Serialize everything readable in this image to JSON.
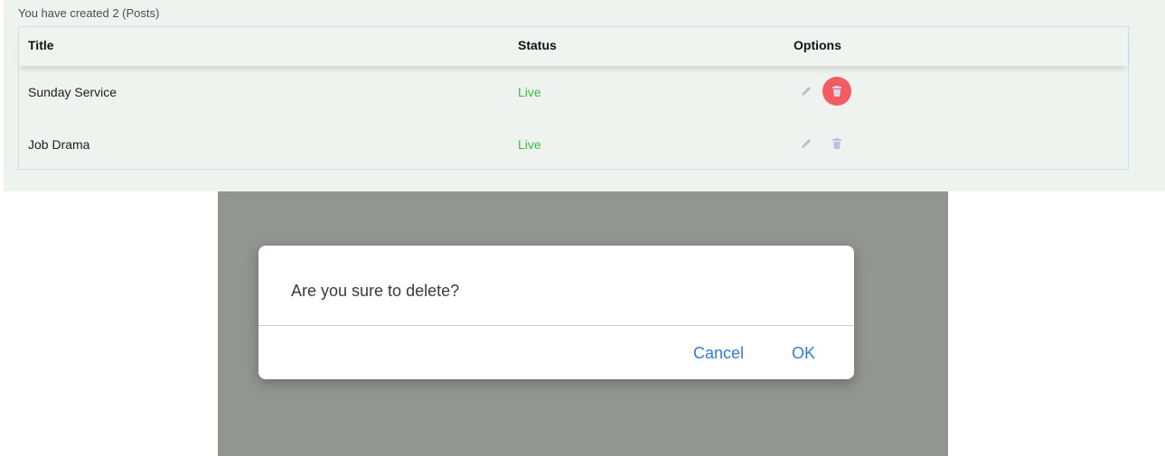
{
  "summary": "You have created 2 (Posts)",
  "table": {
    "headers": {
      "title": "Title",
      "status": "Status",
      "options": "Options"
    },
    "rows": [
      {
        "title": "Sunday Service",
        "status": "Live",
        "delete_active": true
      },
      {
        "title": "Job Drama",
        "status": "Live",
        "delete_active": false
      }
    ]
  },
  "icons": {
    "edit": "pencil-icon",
    "delete": "trash-icon"
  },
  "colors": {
    "status_live": "#3dbb3d",
    "delete_highlight": "#f45b63",
    "dialog_button": "#2f7de1",
    "overlay": "#939593"
  },
  "dialog": {
    "message": "Are you sure to delete?",
    "cancel_label": "Cancel",
    "ok_label": "OK"
  }
}
